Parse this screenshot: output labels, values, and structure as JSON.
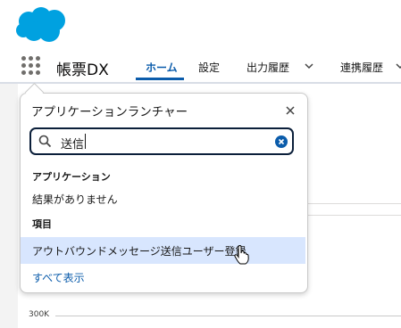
{
  "header": {
    "logo": "salesforce-cloud-logo"
  },
  "nav": {
    "app_name": "帳票DX",
    "tabs": [
      "ホーム",
      "設定",
      "出力履歴",
      "連携履歴"
    ],
    "active_tab": "ホーム"
  },
  "launcher": {
    "title": "アプリケーションランチャー",
    "search_value": "送信",
    "apps_heading": "アプリケーション",
    "apps_empty": "結果がありません",
    "items_heading": "項目",
    "items": [
      "アウトバウンドメッセージ送信ユーザー登録"
    ],
    "show_all": "すべて表示"
  },
  "chart": {
    "axis_label": "300K"
  },
  "colors": {
    "accent": "#0b5cab",
    "logo": "#00a1e0",
    "hover": "#d8e6fe"
  }
}
